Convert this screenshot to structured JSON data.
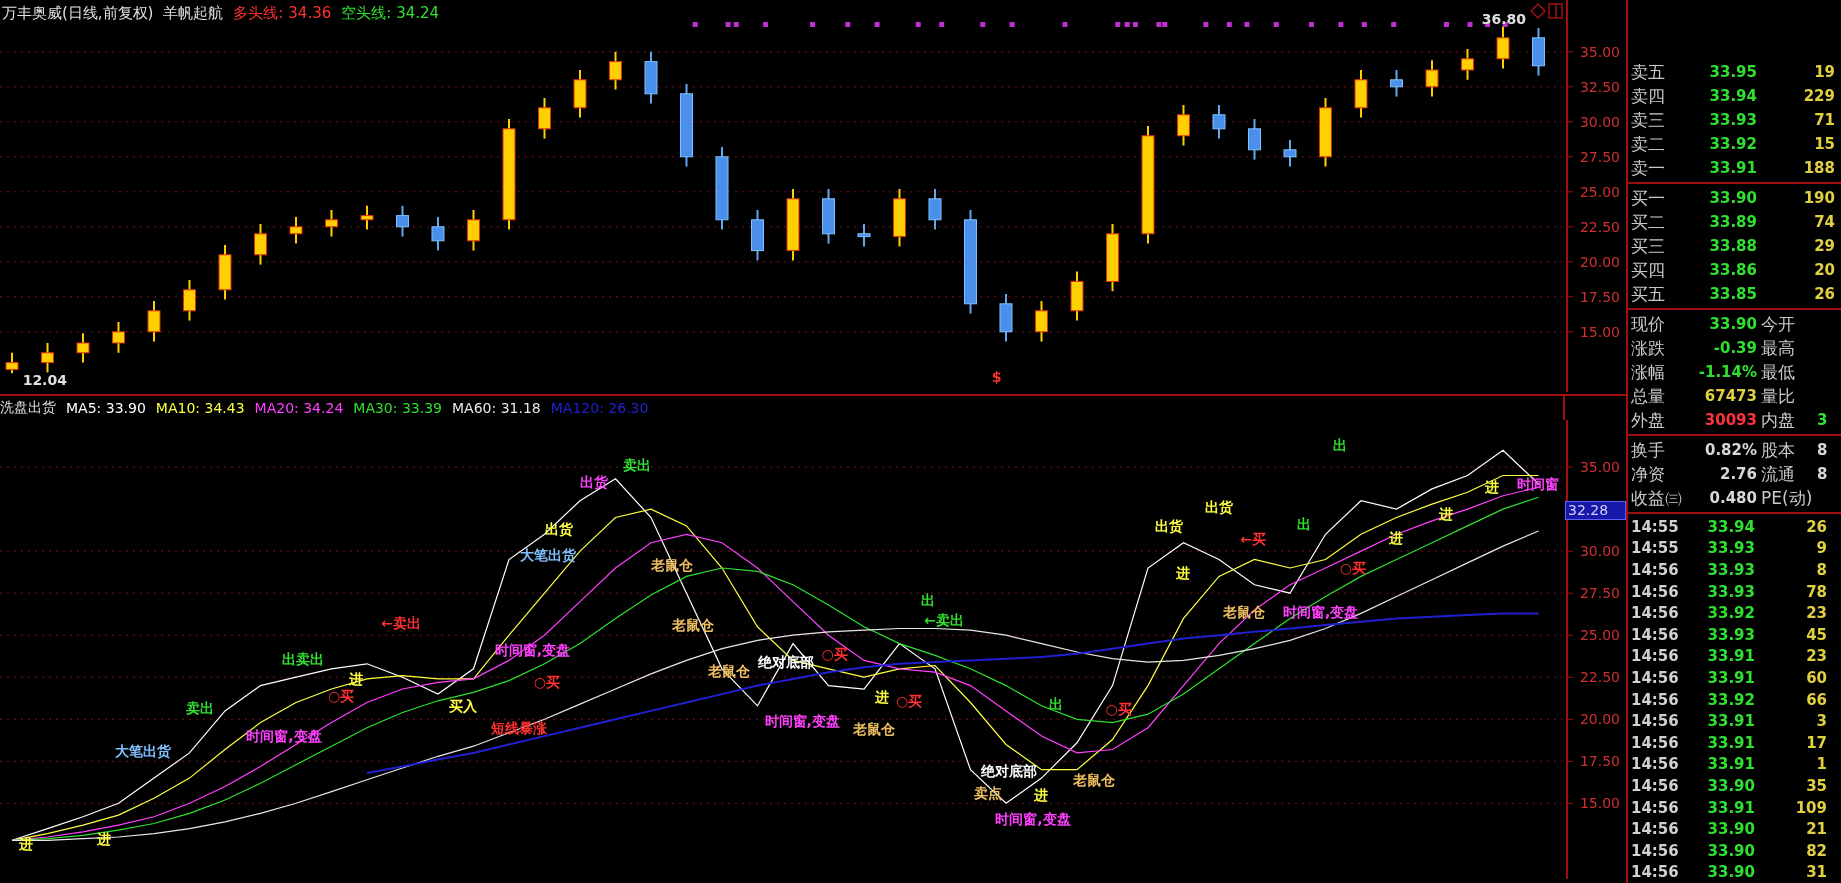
{
  "title": {
    "stock": "万丰奥威(日线,前复权)",
    "indicator": "羊帆起航",
    "lines": [
      {
        "label": "多头线:",
        "value": "34.36",
        "color": "#ff3030"
      },
      {
        "label": "空头线:",
        "value": "34.24",
        "color": "#30e030"
      }
    ]
  },
  "price_chart": {
    "marks": [
      {
        "text": "12.04",
        "color": "#e0e0e0"
      },
      {
        "text": "36.80",
        "color": "#e0e0e0"
      },
      {
        "text": "$",
        "color": "#ff3030"
      }
    ],
    "chart_data": {
      "type": "candlestick",
      "grid": true,
      "ylim": [
        10.7,
        38.7
      ],
      "yticks": [
        {
          "value": 15,
          "label": "15.00"
        },
        {
          "value": 17.5,
          "label": "17.50"
        },
        {
          "value": 20,
          "label": "20.00"
        },
        {
          "value": 22.5,
          "label": "22.50"
        },
        {
          "value": 25,
          "label": "25.00"
        },
        {
          "value": 27.5,
          "label": "27.50"
        },
        {
          "value": 30,
          "label": "30.00"
        },
        {
          "value": 32.5,
          "label": "32.50"
        },
        {
          "value": 35,
          "label": "35.00"
        }
      ],
      "ohlc": [
        [
          12.3,
          13.5,
          12.04,
          12.8
        ],
        [
          12.8,
          14.2,
          12.1,
          13.5
        ],
        [
          13.5,
          14.9,
          12.8,
          14.2
        ],
        [
          14.2,
          15.7,
          13.5,
          15.0
        ],
        [
          15.0,
          17.2,
          14.3,
          16.5
        ],
        [
          16.5,
          18.7,
          15.8,
          18.0
        ],
        [
          18.0,
          21.2,
          17.3,
          20.5
        ],
        [
          20.5,
          22.7,
          19.8,
          22.0
        ],
        [
          22.0,
          23.2,
          21.3,
          22.5
        ],
        [
          22.5,
          23.7,
          21.8,
          23.0
        ],
        [
          23.0,
          24.0,
          22.3,
          23.3
        ],
        [
          23.3,
          24.0,
          21.8,
          22.5
        ],
        [
          22.5,
          23.2,
          20.8,
          21.5
        ],
        [
          21.5,
          23.7,
          20.8,
          23.0
        ],
        [
          23.0,
          30.2,
          22.3,
          29.5
        ],
        [
          29.5,
          31.7,
          28.8,
          31.0
        ],
        [
          31.0,
          33.7,
          30.3,
          33.0
        ],
        [
          33.0,
          35.0,
          32.3,
          34.3
        ],
        [
          34.3,
          35.0,
          31.3,
          32.0
        ],
        [
          32.0,
          32.7,
          26.8,
          27.5
        ],
        [
          27.5,
          28.2,
          22.3,
          23.0
        ],
        [
          23.0,
          23.7,
          20.1,
          20.8
        ],
        [
          20.8,
          25.2,
          20.1,
          24.5
        ],
        [
          24.5,
          25.2,
          21.3,
          22.0
        ],
        [
          22.0,
          22.7,
          21.1,
          21.8
        ],
        [
          21.8,
          25.2,
          21.1,
          24.5
        ],
        [
          24.5,
          25.2,
          22.3,
          23.0
        ],
        [
          23.0,
          23.7,
          16.3,
          17.0
        ],
        [
          17.0,
          17.7,
          14.3,
          15.0
        ],
        [
          15.0,
          17.2,
          14.3,
          16.5
        ],
        [
          16.5,
          19.3,
          15.8,
          18.6
        ],
        [
          18.6,
          22.7,
          17.9,
          22.0
        ],
        [
          22.0,
          29.7,
          21.3,
          29.0
        ],
        [
          29.0,
          31.2,
          28.3,
          30.5
        ],
        [
          30.5,
          31.2,
          28.8,
          29.5
        ],
        [
          29.5,
          30.2,
          27.3,
          28.0
        ],
        [
          28.0,
          28.7,
          26.8,
          27.5
        ],
        [
          27.5,
          31.7,
          26.8,
          31.0
        ],
        [
          31.0,
          33.7,
          30.3,
          33.0
        ],
        [
          33.0,
          33.7,
          31.8,
          32.5
        ],
        [
          32.5,
          34.4,
          31.8,
          33.7
        ],
        [
          33.7,
          35.2,
          33.0,
          34.5
        ],
        [
          34.5,
          36.8,
          33.8,
          36.0
        ],
        [
          36.0,
          36.7,
          33.3,
          34.0
        ]
      ]
    }
  },
  "indicator_chart": {
    "name": "洗盘出货",
    "averages": [
      {
        "label": "MA5:",
        "value": "33.90",
        "color": "#ffffff"
      },
      {
        "label": "MA10:",
        "value": "34.43",
        "color": "#ffff40"
      },
      {
        "label": "MA20:",
        "value": "34.24",
        "color": "#ff40ff"
      },
      {
        "label": "MA30:",
        "value": "33.39",
        "color": "#30e030"
      },
      {
        "label": "MA60:",
        "value": "31.18",
        "color": "#e8e8e8"
      },
      {
        "label": "MA120:",
        "value": "26.30",
        "color": "#2020d0"
      }
    ],
    "current_label": "32.28",
    "signals": [
      {
        "text": "进",
        "color": "#ffff40"
      },
      {
        "text": "进",
        "color": "#ffff40"
      },
      {
        "text": "大笔出货",
        "color": "#80c0ff"
      },
      {
        "text": "卖出",
        "color": "#30e030"
      },
      {
        "text": "时间窗,变盘",
        "color": "#ff40ff"
      },
      {
        "text": "出卖出",
        "color": "#30e030"
      },
      {
        "text": "○买",
        "color": "#ff3030"
      },
      {
        "text": "进",
        "color": "#ffff40"
      },
      {
        "text": "←卖出",
        "color": "#ff3030"
      },
      {
        "text": "买入",
        "color": "#ffff40"
      },
      {
        "text": "出货",
        "color": "#ffff40"
      },
      {
        "text": "大笔出货",
        "color": "#80c0ff"
      },
      {
        "text": "时间窗,变盘",
        "color": "#ff40ff"
      },
      {
        "text": "○买",
        "color": "#ff3030"
      },
      {
        "text": "短线暴涨",
        "color": "#ff3030"
      },
      {
        "text": "出货",
        "color": "#ff40ff"
      },
      {
        "text": "卖出",
        "color": "#30e030"
      },
      {
        "text": "老鼠仓",
        "color": "#f0c060"
      },
      {
        "text": "老鼠仓",
        "color": "#f0c060"
      },
      {
        "text": "老鼠仓",
        "color": "#f0c060"
      },
      {
        "text": "绝对底部",
        "color": "#ffffff"
      },
      {
        "text": "时间窗,变盘",
        "color": "#ff40ff"
      },
      {
        "text": "○买",
        "color": "#ff3030"
      },
      {
        "text": "进",
        "color": "#ffff40"
      },
      {
        "text": "○买",
        "color": "#ff3030"
      },
      {
        "text": "老鼠仓",
        "color": "#f0c060"
      },
      {
        "text": "出",
        "color": "#30e030"
      },
      {
        "text": "←卖出",
        "color": "#30e030"
      },
      {
        "text": "绝对底部",
        "color": "#ffffff"
      },
      {
        "text": "卖点",
        "color": "#f0c060"
      },
      {
        "text": "进",
        "color": "#ffff40"
      },
      {
        "text": "老鼠仓",
        "color": "#f0c060"
      },
      {
        "text": "时间窗,变盘",
        "color": "#ff40ff"
      },
      {
        "text": "出",
        "color": "#30e030"
      },
      {
        "text": "○买",
        "color": "#ff3030"
      },
      {
        "text": "出货",
        "color": "#ffff40"
      },
      {
        "text": "出货",
        "color": "#ffff40"
      },
      {
        "text": "进",
        "color": "#ffff40"
      },
      {
        "text": "老鼠仓",
        "color": "#f0c060"
      },
      {
        "text": "时间窗,变盘",
        "color": "#ff40ff"
      },
      {
        "text": "←买",
        "color": "#ff3030"
      },
      {
        "text": "出",
        "color": "#30e030"
      },
      {
        "text": "○买",
        "color": "#ff3030"
      },
      {
        "text": "出",
        "color": "#30e030"
      },
      {
        "text": "进",
        "color": "#ffff40"
      },
      {
        "text": "进",
        "color": "#ffff40"
      },
      {
        "text": "进",
        "color": "#ffff40"
      },
      {
        "text": "时间窗",
        "color": "#ff40ff"
      }
    ],
    "chart_data": {
      "type": "line",
      "grid": true,
      "ylim": [
        10.5,
        37.8
      ],
      "yticks": [
        {
          "value": 15,
          "label": "15.00"
        },
        {
          "value": 17.5,
          "label": "17.50"
        },
        {
          "value": 20,
          "label": "20.00"
        },
        {
          "value": 22.5,
          "label": "22.50"
        },
        {
          "value": 25,
          "label": "25.00"
        },
        {
          "value": 27.5,
          "label": "27.50"
        },
        {
          "value": 30,
          "label": "30.00"
        },
        {
          "value": 35,
          "label": "35.00"
        }
      ],
      "series": [
        {
          "color": "#ffffff",
          "values": [
            12.8,
            13.5,
            14.2,
            15.0,
            16.5,
            18.0,
            20.5,
            22.0,
            22.5,
            23.0,
            23.3,
            22.5,
            21.5,
            23.0,
            29.5,
            31.0,
            33.0,
            34.3,
            32.0,
            27.5,
            23.0,
            20.8,
            24.5,
            22.0,
            21.8,
            24.5,
            23.0,
            17.0,
            15.0,
            16.5,
            18.6,
            22.0,
            29.0,
            30.5,
            29.5,
            28.0,
            27.5,
            31.0,
            33.0,
            32.5,
            33.7,
            34.5,
            36.0,
            34.0
          ]
        },
        {
          "color": "#ffff40",
          "values": [
            12.8,
            13.2,
            13.7,
            14.3,
            15.3,
            16.5,
            18.2,
            19.8,
            21.0,
            21.8,
            22.4,
            22.6,
            22.4,
            22.4,
            25.0,
            27.5,
            30.0,
            32.0,
            32.5,
            31.5,
            29.0,
            25.5,
            23.5,
            23.0,
            22.5,
            23.0,
            23.2,
            21.0,
            18.5,
            17.0,
            17.0,
            18.8,
            22.0,
            26.0,
            28.5,
            29.5,
            29.0,
            29.5,
            31.0,
            32.0,
            32.8,
            33.5,
            34.5,
            34.5
          ]
        },
        {
          "color": "#ff40ff",
          "values": [
            12.8,
            13.0,
            13.3,
            13.7,
            14.2,
            15.0,
            16.0,
            17.2,
            18.5,
            19.8,
            21.0,
            21.8,
            22.2,
            22.4,
            23.5,
            25.0,
            27.0,
            29.0,
            30.5,
            31.0,
            30.5,
            29.0,
            27.0,
            25.0,
            23.5,
            23.0,
            22.8,
            22.0,
            20.5,
            19.0,
            18.0,
            18.2,
            19.5,
            22.0,
            24.5,
            26.5,
            28.0,
            29.0,
            30.0,
            31.0,
            31.8,
            32.5,
            33.3,
            33.8
          ]
        },
        {
          "color": "#30e030",
          "values": [
            12.8,
            12.9,
            13.1,
            13.4,
            13.8,
            14.4,
            15.2,
            16.2,
            17.3,
            18.4,
            19.5,
            20.4,
            21.1,
            21.6,
            22.3,
            23.3,
            24.5,
            26.0,
            27.4,
            28.5,
            29.0,
            28.8,
            28.0,
            26.8,
            25.5,
            24.5,
            23.8,
            23.0,
            22.0,
            20.8,
            20.0,
            19.8,
            20.3,
            21.5,
            23.0,
            24.5,
            26.0,
            27.3,
            28.5,
            29.5,
            30.5,
            31.5,
            32.5,
            33.2
          ]
        },
        {
          "color": "#e8e8e8",
          "values": [
            12.8,
            12.8,
            12.9,
            13.0,
            13.2,
            13.5,
            13.9,
            14.4,
            15.0,
            15.7,
            16.4,
            17.1,
            17.8,
            18.4,
            19.2,
            20.0,
            20.9,
            21.8,
            22.7,
            23.5,
            24.2,
            24.7,
            25.0,
            25.2,
            25.3,
            25.4,
            25.4,
            25.3,
            25.0,
            24.5,
            24.0,
            23.6,
            23.4,
            23.5,
            23.8,
            24.2,
            24.7,
            25.4,
            26.3,
            27.3,
            28.3,
            29.3,
            30.3,
            31.2
          ]
        },
        {
          "color": "#2020d0",
          "values": [
            null,
            null,
            null,
            null,
            null,
            null,
            null,
            null,
            null,
            null,
            16.8,
            17.2,
            17.6,
            18.0,
            18.5,
            19.0,
            19.5,
            20.0,
            20.5,
            21.0,
            21.5,
            22.0,
            22.4,
            22.8,
            23.1,
            23.3,
            23.4,
            23.5,
            23.6,
            23.7,
            23.9,
            24.2,
            24.5,
            24.8,
            25.0,
            25.2,
            25.4,
            25.6,
            25.8,
            26.0,
            26.1,
            26.2,
            26.3,
            26.3
          ]
        }
      ]
    }
  },
  "order_book": {
    "asks": [
      {
        "label": "卖五",
        "price": "33.95",
        "volume": "19"
      },
      {
        "label": "卖四",
        "price": "33.94",
        "volume": "229"
      },
      {
        "label": "卖三",
        "price": "33.93",
        "volume": "71"
      },
      {
        "label": "卖二",
        "price": "33.92",
        "volume": "15"
      },
      {
        "label": "卖一",
        "price": "33.91",
        "volume": "188"
      }
    ],
    "bids": [
      {
        "label": "买一",
        "price": "33.90",
        "volume": "190"
      },
      {
        "label": "买二",
        "price": "33.89",
        "volume": "74"
      },
      {
        "label": "买三",
        "price": "33.88",
        "volume": "29"
      },
      {
        "label": "买四",
        "price": "33.86",
        "volume": "20"
      },
      {
        "label": "买五",
        "price": "33.85",
        "volume": "26"
      }
    ]
  },
  "quote": [
    {
      "label": "现价",
      "value": {
        "text": "33.90",
        "color": "#30e030"
      },
      "label2": "今开"
    },
    {
      "label": "涨跌",
      "value": {
        "text": "-0.39",
        "color": "#30e030"
      },
      "label2": "最高"
    },
    {
      "label": "涨幅",
      "value": {
        "text": "-1.14%",
        "color": "#30e030"
      },
      "label2": "最低"
    },
    {
      "label": "总量",
      "value": {
        "text": "67473",
        "color": "#e0d040"
      },
      "label2": "量比"
    },
    {
      "label": "外盘",
      "value": {
        "text": "30093",
        "color": "#ff3040"
      },
      "label2": "内盘",
      "value2": {
        "text": "3",
        "color": "#30e030"
      }
    }
  ],
  "stats": [
    {
      "label": "换手",
      "value": "0.82%",
      "label2": "股本",
      "value2": "8"
    },
    {
      "label": "净资",
      "value": "2.76",
      "label2": "流通",
      "value2": "8"
    },
    {
      "label": "收益㈢",
      "value": "0.480",
      "label2": "PE(动)"
    }
  ],
  "trades": [
    {
      "time": "14:55",
      "price": "33.94",
      "volume": "26"
    },
    {
      "time": "14:55",
      "price": "33.93",
      "volume": "9"
    },
    {
      "time": "14:56",
      "price": "33.93",
      "volume": "8"
    },
    {
      "time": "14:56",
      "price": "33.93",
      "volume": "78"
    },
    {
      "time": "14:56",
      "price": "33.92",
      "volume": "23"
    },
    {
      "time": "14:56",
      "price": "33.93",
      "volume": "45"
    },
    {
      "time": "14:56",
      "price": "33.91",
      "volume": "23"
    },
    {
      "time": "14:56",
      "price": "33.91",
      "volume": "60"
    },
    {
      "time": "14:56",
      "price": "33.92",
      "volume": "66"
    },
    {
      "time": "14:56",
      "price": "33.91",
      "volume": "3"
    },
    {
      "time": "14:56",
      "price": "33.91",
      "volume": "17"
    },
    {
      "time": "14:56",
      "price": "33.91",
      "volume": "1"
    },
    {
      "time": "14:56",
      "price": "33.90",
      "volume": "35"
    },
    {
      "time": "14:56",
      "price": "33.91",
      "volume": "109"
    },
    {
      "time": "14:56",
      "price": "33.90",
      "volume": "21"
    },
    {
      "time": "14:56",
      "price": "33.90",
      "volume": "82"
    },
    {
      "time": "14:56",
      "price": "33.90",
      "volume": "31"
    }
  ]
}
